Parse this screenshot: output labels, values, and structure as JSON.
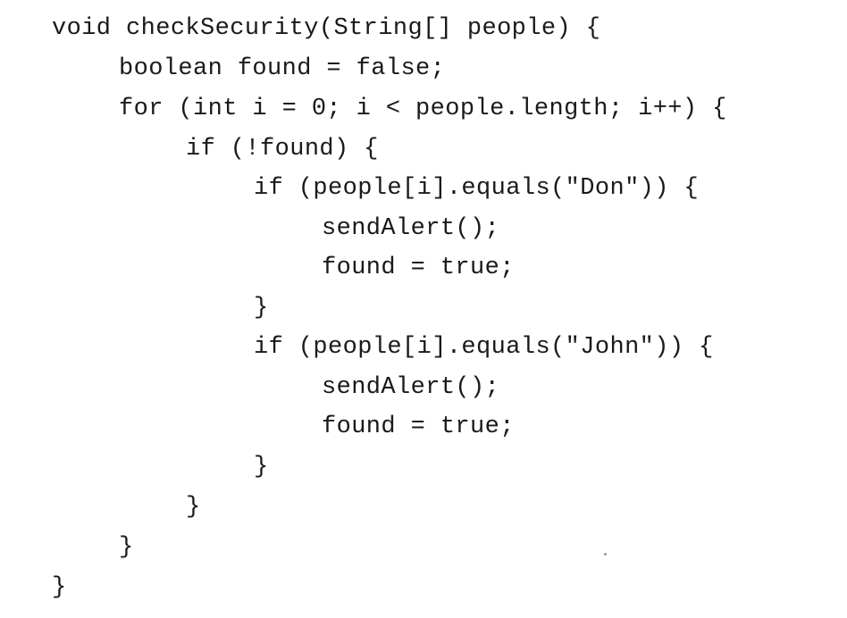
{
  "code": {
    "lines": [
      "void checkSecurity(String[] people) {",
      "boolean found = false;",
      "for (int i = 0; i < people.length; i++) {",
      "if (!found) {",
      "if (people[i].equals(\"Don\")) {",
      "sendAlert();",
      "found = true;",
      "}",
      "if (people[i].equals(\"John\")) {",
      "sendAlert();",
      "found = true;",
      "}",
      "}",
      "}",
      "}"
    ]
  }
}
